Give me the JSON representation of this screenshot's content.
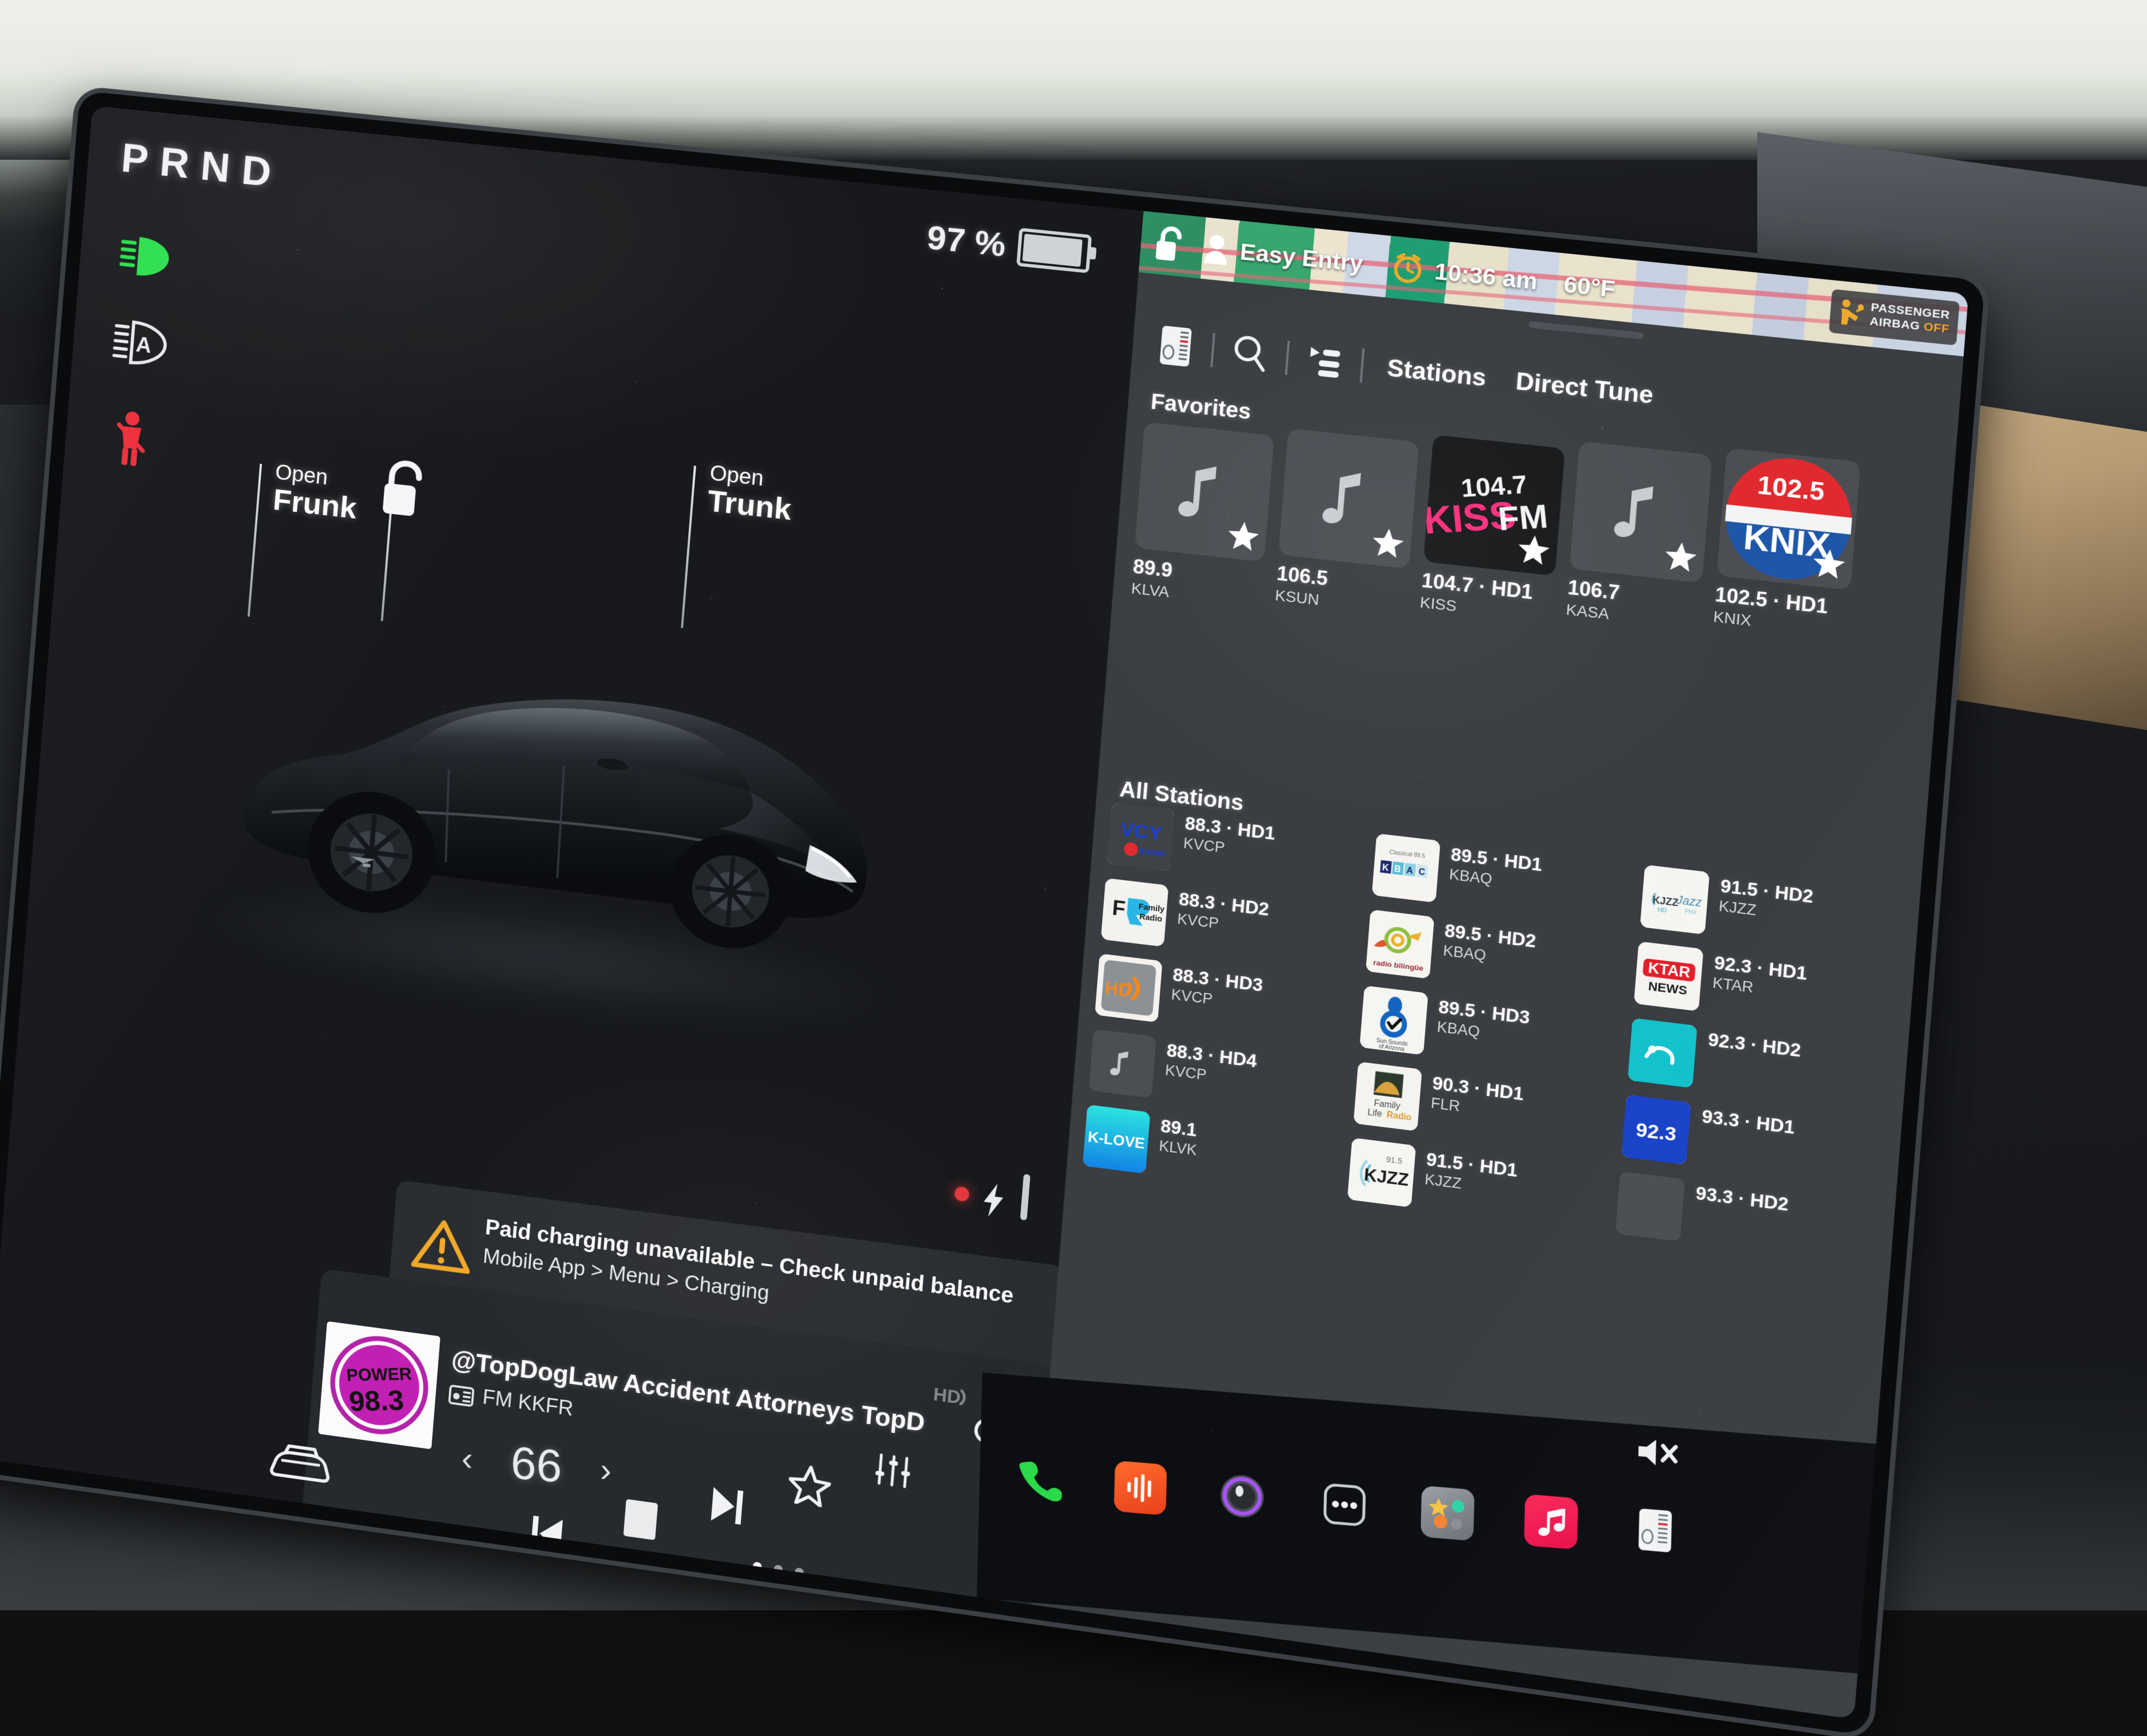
{
  "drive": {
    "gear_indicator": "PRND",
    "battery_percent": "97 %",
    "telltales": [
      "high-beam-green",
      "auto-high-beam",
      "seatbelt-red"
    ],
    "callouts": {
      "frunk_small": "Open",
      "frunk_big": "Frunk",
      "trunk_small": "Open",
      "trunk_big": "Trunk"
    }
  },
  "alert": {
    "line1": "Paid charging unavailable – Check unpaid balance",
    "line2": "Mobile App > Menu > Charging"
  },
  "media_bar": {
    "title": "@TopDogLaw Accident Attorneys TopD",
    "source": "FM KKFR",
    "album_art_line1": "POWER",
    "album_art_line2": "98.3",
    "hd_badge": "HD",
    "page_dots": 3
  },
  "status": {
    "lock_icon": "unlocked-padlock-icon",
    "profile": "Easy Entry",
    "clock_icon": "alarm-clock-icon",
    "time": "10:36 am",
    "temperature": "60°F",
    "airbag_line1": "PASSENGER",
    "airbag_line2": "AIRBAG",
    "airbag_state": "OFF"
  },
  "toolbar": {
    "icons": [
      "radio-tuner-icon",
      "search-icon",
      "playlist-icon"
    ],
    "tabs": [
      {
        "label": "Stations",
        "active": true
      },
      {
        "label": "Direct Tune",
        "active": false
      }
    ]
  },
  "sections": {
    "favorites_header": "Favorites",
    "all_stations_header": "All Stations"
  },
  "favorites": [
    {
      "freq": "89.9",
      "call": "KLVA",
      "logo": "music-note",
      "starred": true
    },
    {
      "freq": "106.5",
      "call": "KSUN",
      "logo": "music-note",
      "starred": true
    },
    {
      "freq": "104.7 · HD1",
      "call": "KISS",
      "logo": "kissfm",
      "starred": true
    },
    {
      "freq": "106.7",
      "call": "KASA",
      "logo": "music-note",
      "starred": true
    },
    {
      "freq": "102.5 · HD1",
      "call": "KNIX",
      "logo": "knix",
      "starred": true
    }
  ],
  "all_stations": [
    {
      "freq": "88.3 · HD1",
      "call": "KVCP",
      "logo": "vcy"
    },
    {
      "freq": "88.3 · HD2",
      "call": "KVCP",
      "logo": "familyradio"
    },
    {
      "freq": "88.3 · HD3",
      "call": "KVCP",
      "logo": "hdradio"
    },
    {
      "freq": "88.3 · HD4",
      "call": "KVCP",
      "logo": "music-note"
    },
    {
      "freq": "89.1",
      "call": "KLVK",
      "logo": "klove"
    },
    {
      "freq": "89.5 · HD1",
      "call": "KBAQ",
      "logo": "kbach"
    },
    {
      "freq": "89.5 · HD2",
      "call": "KBAQ",
      "logo": "radiobilingue"
    },
    {
      "freq": "89.5 · HD3",
      "call": "KBAQ",
      "logo": "sunsounds"
    },
    {
      "freq": "90.3 · HD1",
      "call": "FLR",
      "logo": "familylife"
    },
    {
      "freq": "91.5 · HD1",
      "call": "KJZZ",
      "logo": "kjzz"
    },
    {
      "freq": "91.5 · HD2",
      "call": "KJZZ",
      "logo": "kjzzjazz"
    },
    {
      "freq": "92.3 · HD1",
      "call": "KTAR",
      "logo": "ktar"
    },
    {
      "freq": "92.3 · HD2",
      "call": "",
      "logo": "teal"
    },
    {
      "freq": "93.3 · HD1",
      "call": "",
      "logo": "blue923"
    },
    {
      "freq": "93.3 · HD2",
      "call": "",
      "logo": "none"
    }
  ],
  "dock": {
    "icons": [
      "phone-icon",
      "voice-memos-icon",
      "camera-icon",
      "more-apps-icon",
      "contacts-icon",
      "music-icon",
      "climate-icon"
    ],
    "mute_icon": "mute-icon"
  },
  "climate": {
    "temperature": "66",
    "decrease": "‹",
    "increase": "›"
  },
  "colors": {
    "screen_bg": "#17191c",
    "panel_bg": "#3a3d41",
    "tile_bg": "#4b4f54",
    "accent_green": "#27e04a",
    "accent_red": "#e2383c",
    "accent_amber": "#f2a42b",
    "dock_bg": "#0c0e13"
  }
}
